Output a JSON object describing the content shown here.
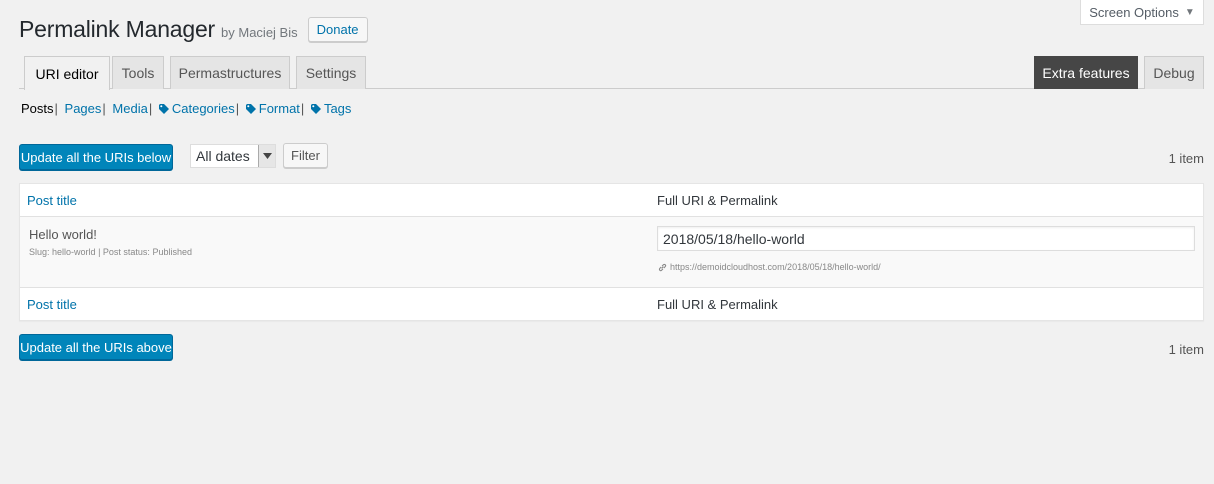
{
  "header": {
    "title": "Permalink Manager",
    "byline": "by Maciej Bis",
    "donate_label": "Donate"
  },
  "screen_options": {
    "label": "Screen Options",
    "caret": "▼"
  },
  "tabs": [
    {
      "label": "URI editor",
      "active": true
    },
    {
      "label": "Tools"
    },
    {
      "label": "Permastructures"
    },
    {
      "label": "Settings"
    }
  ],
  "right_tabs": [
    {
      "label": "Extra features"
    },
    {
      "label": "Debug"
    }
  ],
  "subnav": {
    "current": "Posts",
    "links": [
      "Pages",
      "Media",
      "Categories",
      "Format",
      "Tags"
    ],
    "separator": "|"
  },
  "toolbar_top": {
    "update_label": "Update all the URIs below",
    "date_value": "All dates",
    "filter_label": "Filter",
    "count": "1 item"
  },
  "table": {
    "col_title": "Post title",
    "col_uri": "Full URI & Permalink",
    "rows": [
      {
        "title": "Hello world!",
        "slug_label": "Slug:",
        "slug": "hello-world",
        "status_label": "Post status:",
        "status": "Published",
        "uri": "2018/05/18/hello-world",
        "permalink": "https://demoidcloudhost.com/2018/05/18/hello-world/"
      }
    ]
  },
  "toolbar_bottom": {
    "update_label": "Update all the URIs above",
    "count": "1 item"
  },
  "colors": {
    "primary": "#0085ba",
    "link": "#0073aa",
    "dark_tab": "#464646"
  }
}
